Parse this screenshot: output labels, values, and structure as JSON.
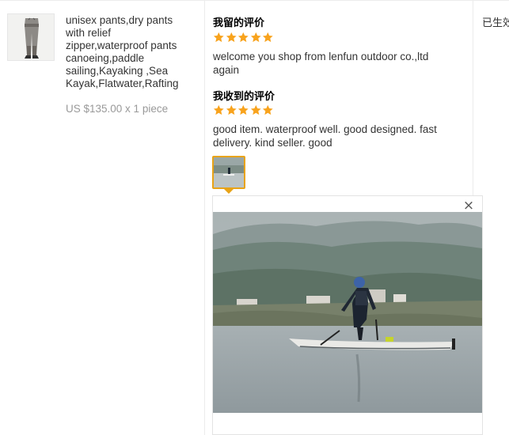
{
  "product": {
    "title": "unisex pants,dry pants with relief zipper,waterproof pants canoeing,paddle sailing,Kayaking ,Sea Kayak,Flatwater,Rafting",
    "price": "US $135.00 x 1 piece",
    "image_icon": "pants-product-image"
  },
  "feedback": {
    "left": {
      "heading": "我留的评价",
      "rating": 5,
      "text": "welcome you shop from lenfun outdoor co.,ltd again"
    },
    "received": {
      "heading": "我收到的评价",
      "rating": 5,
      "text": "good item. waterproof well. good designed. fast delivery. kind seller. good"
    },
    "attachment_icon": "kayak-photo-thumbnail",
    "photo_icon": "kayak-photo",
    "close_label": "×"
  },
  "status": {
    "text": "已生效"
  },
  "colors": {
    "star": "#f8a31d",
    "accent_border": "#e8a317",
    "price_gray": "#999999"
  }
}
